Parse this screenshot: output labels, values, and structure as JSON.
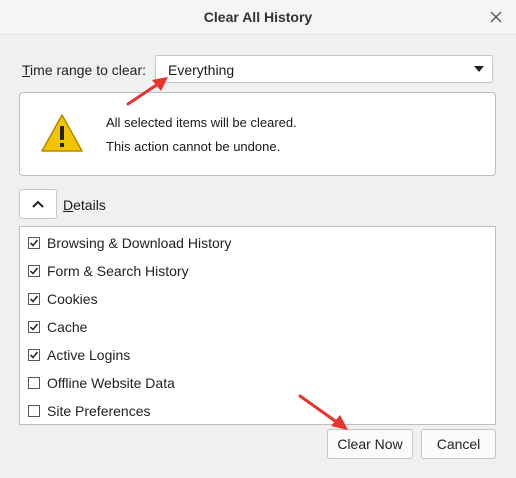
{
  "dialog": {
    "title": "Clear All History"
  },
  "time_range": {
    "label_prefix": "T",
    "label_rest": "ime range to clear:",
    "selected": "Everything"
  },
  "warning": {
    "line1": "All selected items will be cleared.",
    "line2": "This action cannot be undone."
  },
  "details": {
    "label_prefix": "D",
    "label_rest": "etails",
    "expanded": true
  },
  "items": [
    {
      "label": "Browsing & Download History",
      "checked": true
    },
    {
      "label": "Form & Search History",
      "checked": true
    },
    {
      "label": "Cookies",
      "checked": true
    },
    {
      "label": "Cache",
      "checked": true
    },
    {
      "label": "Active Logins",
      "checked": true
    },
    {
      "label": "Offline Website Data",
      "checked": false
    },
    {
      "label": "Site Preferences",
      "checked": false
    }
  ],
  "buttons": {
    "clear": "Clear Now",
    "cancel": "Cancel"
  },
  "colors": {
    "warning_yellow": "#f5c400",
    "annotation_red": "#e8322c"
  },
  "icons": [
    "close-icon",
    "chevron-down-icon",
    "warning-icon",
    "chevron-up-icon",
    "checkmark-icon"
  ]
}
